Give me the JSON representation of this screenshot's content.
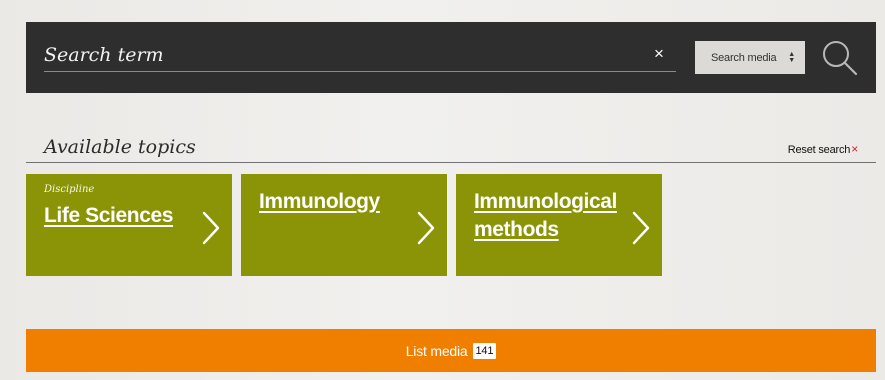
{
  "search": {
    "placeholder": "Search term",
    "clear_icon": "close-icon",
    "select_label": "Search media",
    "select_icon": "sort-arrows-icon",
    "button_icon": "search-icon"
  },
  "topics": {
    "title": "Available topics",
    "reset_label": "Reset search",
    "reset_icon": "close-icon",
    "cards": [
      {
        "kicker": "Discipline",
        "label": "Life Sciences",
        "icon": "chevron-right-icon"
      },
      {
        "label": "Immunology",
        "icon": "chevron-right-icon"
      },
      {
        "label": "Immunological methods",
        "icon": "chevron-right-icon"
      }
    ]
  },
  "list_media": {
    "label": "List media",
    "count": "141"
  },
  "colors": {
    "search_background": "#2e2e2e",
    "topic_background": "#8b9407",
    "primary_button": "#f07f00",
    "reset_icon": "#d21f1f"
  }
}
